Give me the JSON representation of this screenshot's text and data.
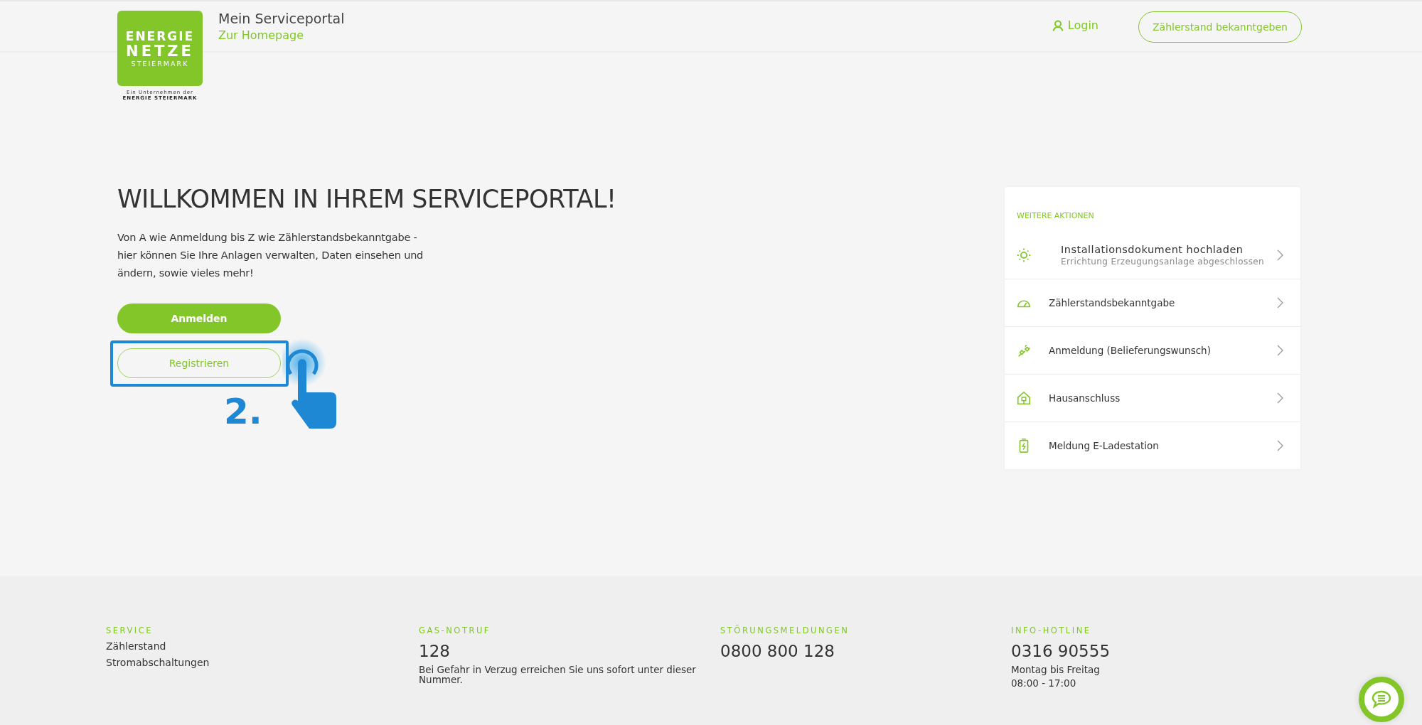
{
  "header": {
    "logo": {
      "line1": "ENERGIE",
      "line2": "NETZE",
      "line3": "STEIERMARK",
      "tagline1": "Ein Unternehmen der",
      "tagline2": "ENERGIE STEIERMARK"
    },
    "title": "Mein Serviceportal",
    "home_link": "Zur Homepage",
    "login": "Login",
    "meter_button": "Zählerstand bekanntgeben"
  },
  "hero": {
    "heading": "WILLKOMMEN IN IHREM SERVICEPORTAL!",
    "text": "Von A wie Anmeldung bis Z wie Zählerstandsbekanntgabe - hier können Sie Ihre Anlagen verwalten, Daten einsehen und ändern, sowie vieles mehr!",
    "buttons": [
      {
        "label": "Anmelden",
        "kind": "primary",
        "highlighted": false
      },
      {
        "label": "Registrieren",
        "kind": "outline",
        "highlighted": true
      }
    ],
    "step_marker": "2."
  },
  "actions": {
    "title": "WEITERE AKTIONEN",
    "items": [
      {
        "kind": "sun",
        "label": "Installationsdokument hochladen",
        "sublabel": "Errichtung Erzeugungsanlage abgeschlossen"
      },
      {
        "kind": "gauge",
        "label": "Zählerstandsbekanntgabe"
      },
      {
        "kind": "plug",
        "label": "Anmeldung (Belieferungswunsch)"
      },
      {
        "kind": "house",
        "label": "Hausanschluss"
      },
      {
        "kind": "battery",
        "label": "Meldung E-Ladestation"
      }
    ]
  },
  "footer": {
    "columns": [
      {
        "title": "SERVICE",
        "links": [
          "Zählerstand",
          "Stromabschaltungen"
        ]
      },
      {
        "title": "GAS-NOTRUF",
        "number": "128",
        "lines": [
          "Bei Gefahr in Verzug erreichen Sie uns sofort unter dieser Nummer."
        ]
      },
      {
        "title": "STÖRUNGSMELDUNGEN",
        "number": "0800 800 128"
      },
      {
        "title": "INFO-HOTLINE",
        "number": "0316 90555",
        "lines": [
          "Montag bis Freitag",
          "08:00 - 17:00"
        ]
      }
    ]
  }
}
